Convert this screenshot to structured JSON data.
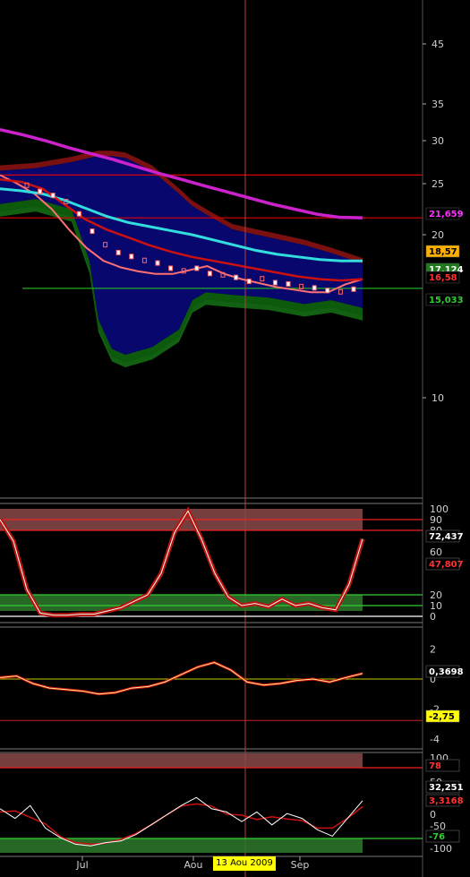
{
  "chart_data": {
    "type": "line",
    "cursor_date": "13 Aou 2009",
    "x_axis": {
      "months": [
        "Jul",
        "Aou",
        "Sep"
      ]
    },
    "main": {
      "y_ticks": [
        "45",
        "35",
        "30",
        "25",
        "20",
        "10"
      ],
      "labels": [
        {
          "text": "21,659",
          "color": "#ff33ff",
          "bg": "#000000"
        },
        {
          "text": "18,57",
          "color": "#000000",
          "bg": "#ffb000"
        },
        {
          "text": "17,124",
          "color": "#ffffff",
          "bg": "#1d7a1d"
        },
        {
          "text": "16,58",
          "color": "#ff3333",
          "bg": "#000000"
        },
        {
          "text": "15,033",
          "color": "#33cc33",
          "bg": "#000000"
        }
      ],
      "series": [
        {
          "role": "price",
          "values": [
            26.0,
            25.0,
            24.0,
            22.5,
            20.5,
            19.0,
            18.0,
            17.5,
            17.2,
            17.0,
            17.0,
            17.3,
            17.6,
            17.0,
            16.6,
            16.3,
            16.0,
            15.8,
            15.6,
            15.6,
            16.2,
            16.6
          ]
        },
        {
          "role": "ma-magenta",
          "values": [
            31.5,
            30.8,
            30.0,
            29.2,
            28.5,
            27.8,
            27.0,
            26.2,
            25.5,
            24.8,
            24.2,
            23.6,
            23.0,
            22.5,
            22.0,
            21.7,
            21.66
          ]
        },
        {
          "role": "ma-cyan",
          "values": [
            24.5,
            24.3,
            24.0,
            23.4,
            22.6,
            21.8,
            21.2,
            20.8,
            20.4,
            20.0,
            19.6,
            19.2,
            18.8,
            18.5,
            18.3,
            18.1,
            18.0,
            18.0
          ]
        },
        {
          "role": "ma-red",
          "values": [
            25.5,
            25.2,
            24.5,
            23.0,
            21.5,
            20.5,
            19.8,
            19.2,
            18.7,
            18.3,
            18.0,
            17.7,
            17.4,
            17.1,
            16.8,
            16.6,
            16.5,
            16.6
          ]
        }
      ],
      "hlines": [
        26.0,
        21.65,
        15.9
      ]
    },
    "stochastic": {
      "y_ticks": [
        "100",
        "90",
        "80",
        "60",
        "20",
        "10",
        "0"
      ],
      "labels": [
        {
          "text": "72,437",
          "color": "#ffffff",
          "bg": "#000000"
        },
        {
          "text": "47,807",
          "color": "#ff3333",
          "bg": "#000000"
        }
      ],
      "values": [
        90,
        70,
        25,
        3,
        1,
        1,
        2,
        2,
        5,
        8,
        14,
        20,
        40,
        78,
        98,
        72,
        40,
        18,
        10,
        12,
        9,
        16,
        10,
        12,
        8,
        6,
        30,
        72
      ]
    },
    "oscillator": {
      "y_ticks": [
        "2",
        "0",
        "-2",
        "-4"
      ],
      "labels": [
        {
          "text": "0,3698",
          "color": "#ffffff",
          "bg": "#000000"
        },
        {
          "text": "-2,75",
          "color": "#000000",
          "bg": "#ffff00"
        }
      ],
      "values": [
        0.1,
        0.2,
        -0.3,
        -0.6,
        -0.7,
        -0.8,
        -1.0,
        -0.9,
        -0.6,
        -0.5,
        -0.2,
        0.3,
        0.8,
        1.1,
        0.6,
        -0.2,
        -0.4,
        -0.3,
        -0.1,
        0.0,
        -0.2,
        0.1,
        0.37
      ]
    },
    "cci": {
      "y_ticks": [
        "100",
        "50",
        "0",
        "-50",
        "-100"
      ],
      "labels": [
        {
          "text": "78",
          "color": "#ff3333",
          "bg": "#000000"
        },
        {
          "text": "32,251",
          "color": "#ffffff",
          "bg": "#000000"
        },
        {
          "text": "3,3168",
          "color": "#ff3333",
          "bg": "#000000"
        },
        {
          "text": "-76",
          "color": "#33cc33",
          "bg": "#000000"
        }
      ],
      "values": [
        20,
        -10,
        30,
        -40,
        -70,
        -90,
        -95,
        -85,
        -80,
        -60,
        -30,
        0,
        30,
        55,
        20,
        10,
        -20,
        10,
        -30,
        5,
        -10,
        -45,
        -65,
        -10,
        45
      ]
    }
  }
}
